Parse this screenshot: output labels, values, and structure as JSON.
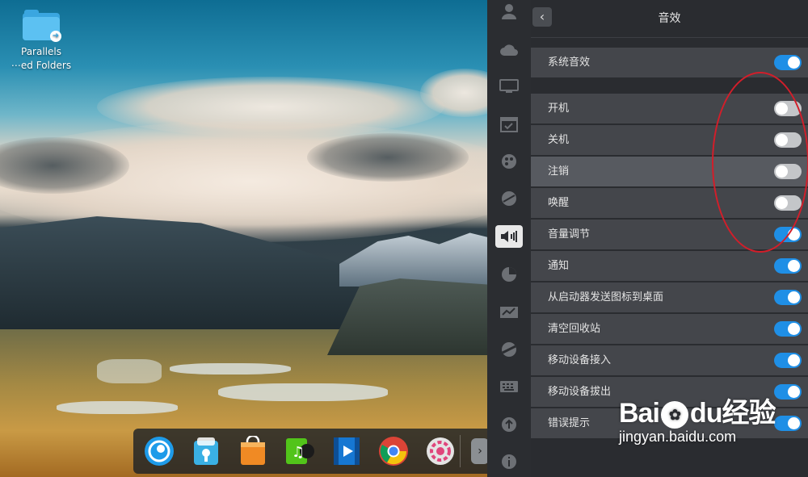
{
  "desktop": {
    "icon": {
      "line1": "Parallels",
      "line2": "⋯ed Folders"
    }
  },
  "dock": {
    "items": [
      {
        "name": "deepin-launcher",
        "icon": "deepin-logo-icon"
      },
      {
        "name": "app-store",
        "icon": "store-icon"
      },
      {
        "name": "shopping-bag",
        "icon": "shopping-bag-icon"
      },
      {
        "name": "music-player",
        "icon": "music-icon"
      },
      {
        "name": "video-player",
        "icon": "video-icon"
      },
      {
        "name": "chrome-browser",
        "icon": "chrome-icon"
      },
      {
        "name": "settings",
        "icon": "gear-icon"
      }
    ],
    "more": "›"
  },
  "control_center": {
    "back": "‹",
    "title": "音效",
    "master": {
      "label": "系统音效",
      "on": true
    },
    "items": [
      {
        "label": "开机",
        "on": false
      },
      {
        "label": "关机",
        "on": false
      },
      {
        "label": "注销",
        "on": false
      },
      {
        "label": "唤醒",
        "on": false
      },
      {
        "label": "音量调节",
        "on": true
      },
      {
        "label": "通知",
        "on": true
      },
      {
        "label": "从启动器发送图标到桌面",
        "on": true
      },
      {
        "label": "清空回收站",
        "on": true
      },
      {
        "label": "移动设备接入",
        "on": true
      },
      {
        "label": "移动设备拔出",
        "on": true
      },
      {
        "label": "错误提示",
        "on": true
      }
    ],
    "nav": [
      "user-icon",
      "cloud-icon",
      "display-icon",
      "calendar-icon",
      "personalization-icon",
      "network-icon",
      "sound-icon",
      "power-icon",
      "mouse-icon",
      "update-icon",
      "keyboard-icon",
      "upload-icon",
      "info-icon"
    ]
  },
  "colors": {
    "accent": "#1f8fe6",
    "annotation": "#d21e2a"
  },
  "watermark": {
    "logo_a": "Bai",
    "logo_b": "du",
    "logo_c": "经验",
    "url": "jingyan.baidu.com"
  }
}
